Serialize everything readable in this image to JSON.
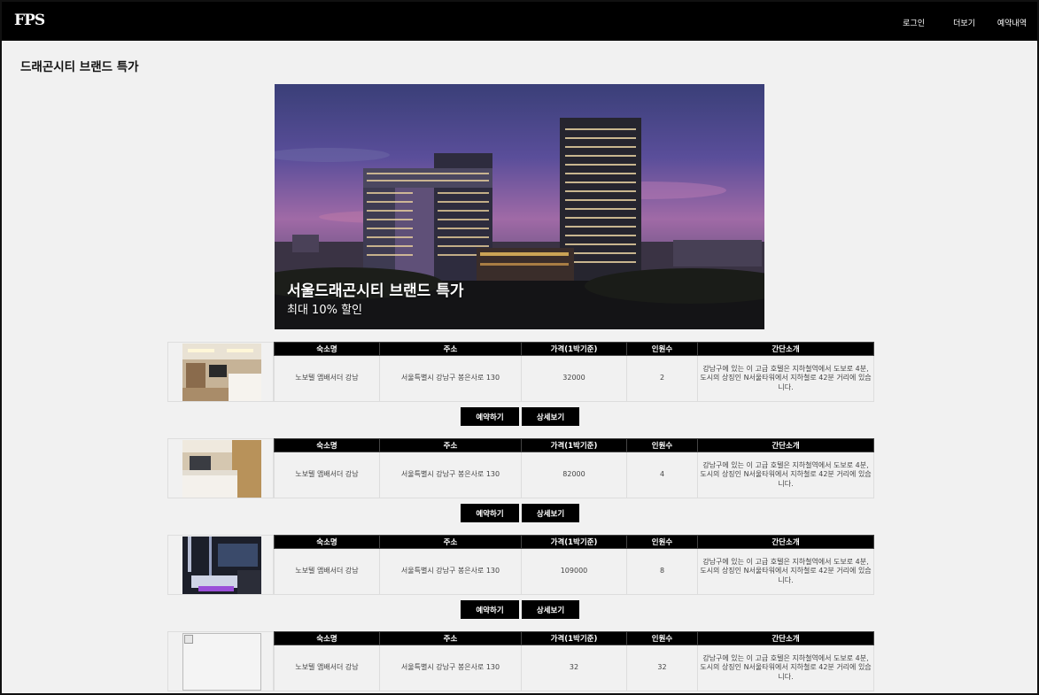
{
  "header": {
    "logo": "FPS",
    "nav": [
      "로그인",
      "더보기",
      "예약내역"
    ]
  },
  "page_title": "드래곤시티 브랜드 특가",
  "hero": {
    "title": "서울드래곤시티 브랜드 특가",
    "subtitle": "최대 10% 할인"
  },
  "table_headers": [
    "숙소명",
    "주소",
    "가격(1박기준)",
    "인원수",
    "간단소개"
  ],
  "buttons": {
    "reserve": "예약하기",
    "detail": "상세보기"
  },
  "listings": [
    {
      "name": "노보텔 앰배서더 강남",
      "address": "서울특별시 강남구 봉은사로 130",
      "price": "32000",
      "guests": "2",
      "intro": "강남구에 있는 이 고급 호텔은 지하철역에서 도보로 4분, 도시의 상징인 N서울타워에서 지하철로 42분 거리에 있습니다."
    },
    {
      "name": "노보텔 앰배서더 강남",
      "address": "서울특별시 강남구 봉은사로 130",
      "price": "82000",
      "guests": "4",
      "intro": "강남구에 있는 이 고급 호텔은 지하철역에서 도보로 4분, 도시의 상징인 N서울타워에서 지하철로 42분 거리에 있습니다."
    },
    {
      "name": "노보텔 앰배서더 강남",
      "address": "서울특별시 강남구 봉은사로 130",
      "price": "109000",
      "guests": "8",
      "intro": "강남구에 있는 이 고급 호텔은 지하철역에서 도보로 4분, 도시의 상징인 N서울타워에서 지하철로 42분 거리에 있습니다."
    },
    {
      "name": "노보텔 앰배서더 강남",
      "address": "서울특별시 강남구 봉은사로 130",
      "price": "32",
      "guests": "32",
      "intro": "강남구에 있는 이 고급 호텔은 지하철역에서 도보로 4분, 도시의 상징인 N서울타워에서 지하철로 42분 거리에 있습니다."
    }
  ]
}
